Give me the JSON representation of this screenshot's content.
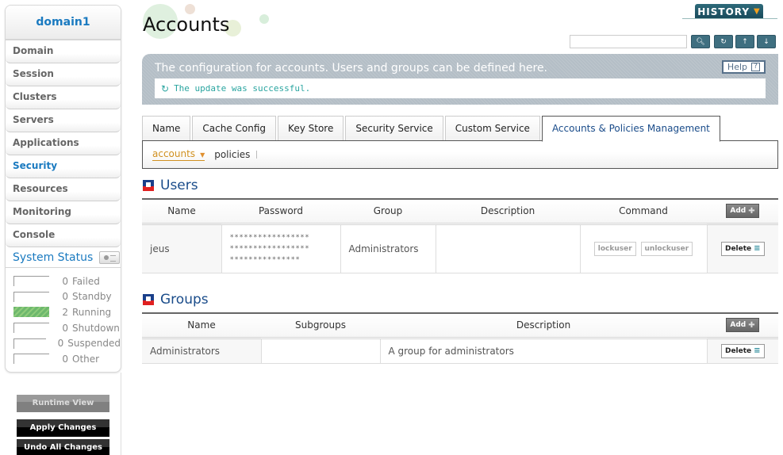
{
  "sidebar": {
    "domain": "domain1",
    "nav": [
      {
        "label": "Domain",
        "active": false
      },
      {
        "label": "Session",
        "active": false
      },
      {
        "label": "Clusters",
        "active": false
      },
      {
        "label": "Servers",
        "active": false
      },
      {
        "label": "Applications",
        "active": false
      },
      {
        "label": "Security",
        "active": true
      },
      {
        "label": "Resources",
        "active": false
      },
      {
        "label": "Monitoring",
        "active": false
      },
      {
        "label": "Console",
        "active": false
      }
    ],
    "system_status": {
      "title": "System Status",
      "rows": [
        {
          "count": "0",
          "label": "Failed"
        },
        {
          "count": "0",
          "label": "Standby"
        },
        {
          "count": "2",
          "label": "Running"
        },
        {
          "count": "0",
          "label": "Shutdown"
        },
        {
          "count": "0",
          "label": "Suspended"
        },
        {
          "count": "0",
          "label": "Other"
        }
      ]
    },
    "buttons": {
      "runtime_view": "Runtime View",
      "apply_changes": "Apply Changes",
      "undo_all": "Undo All Changes"
    }
  },
  "header": {
    "title": "Accounts",
    "history": "HISTORY",
    "search_value": "",
    "tools": [
      "search-icon",
      "refresh-icon",
      "xml-upload-icon",
      "xml-download-icon"
    ]
  },
  "banner": {
    "text": "The configuration for accounts. Users and groups can be defined here.",
    "help": "Help",
    "message": "The update was successful."
  },
  "tabs": [
    {
      "label": "Name",
      "active": false
    },
    {
      "label": "Cache Config",
      "active": false
    },
    {
      "label": "Key Store",
      "active": false
    },
    {
      "label": "Security Service",
      "active": false
    },
    {
      "label": "Custom Service",
      "active": false
    },
    {
      "label": "Accounts & Policies Management",
      "active": true
    }
  ],
  "subtabs": [
    {
      "label": "accounts",
      "active": true
    },
    {
      "label": "policies",
      "active": false
    }
  ],
  "users": {
    "title": "Users",
    "columns": [
      "Name",
      "Password",
      "Group",
      "Description",
      "Command"
    ],
    "add_label": "Add",
    "rows": [
      {
        "name": "jeus",
        "password_lines": [
          "*****************",
          "*****************",
          "***************"
        ],
        "group": "Administrators",
        "description": "",
        "commands": [
          "lockuser",
          "unlockuser"
        ],
        "delete_label": "Delete"
      }
    ]
  },
  "groups": {
    "title": "Groups",
    "columns": [
      "Name",
      "Subgroups",
      "Description"
    ],
    "add_label": "Add",
    "rows": [
      {
        "name": "Administrators",
        "subgroups": "",
        "description": "A group for administrators",
        "delete_label": "Delete"
      }
    ]
  },
  "colors": {
    "accent_blue": "#1a7ac0",
    "title_navy": "#1a4c8a",
    "success_teal": "#2aa5a0",
    "subtab_active": "#d09020",
    "running_green": "#6db86d"
  }
}
